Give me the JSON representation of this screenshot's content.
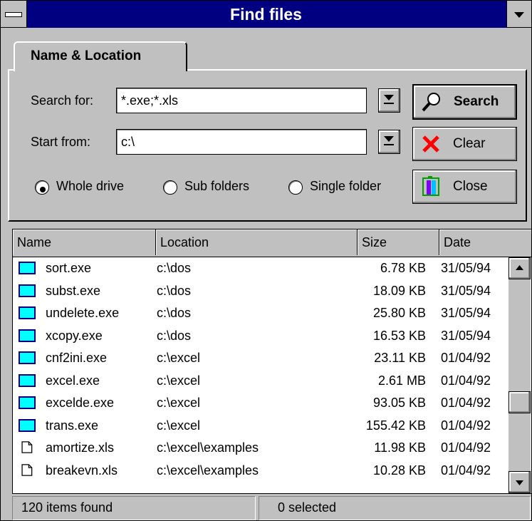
{
  "window": {
    "title": "Find files"
  },
  "tabs": [
    {
      "label": "Name & Location"
    }
  ],
  "form": {
    "search_for_label": "Search for:",
    "search_for_value": "*.exe;*.xls",
    "start_from_label": "Start from:",
    "start_from_value": "c:\\",
    "scope_options": [
      "Whole drive",
      "Sub folders",
      "Single folder"
    ],
    "scope_selected": "Whole drive"
  },
  "buttons": {
    "search": "Search",
    "clear": "Clear",
    "close": "Close"
  },
  "list": {
    "columns": [
      "Name",
      "Location",
      "Size",
      "Date"
    ],
    "rows": [
      {
        "icon": "exe-file-icon",
        "name": "sort.exe",
        "location": "c:\\dos",
        "size": "6.78 KB",
        "date": "31/05/94"
      },
      {
        "icon": "exe-file-icon",
        "name": "subst.exe",
        "location": "c:\\dos",
        "size": "18.09 KB",
        "date": "31/05/94"
      },
      {
        "icon": "exe-file-icon",
        "name": "undelete.exe",
        "location": "c:\\dos",
        "size": "25.80 KB",
        "date": "31/05/94"
      },
      {
        "icon": "exe-file-icon",
        "name": "xcopy.exe",
        "location": "c:\\dos",
        "size": "16.53 KB",
        "date": "31/05/94"
      },
      {
        "icon": "exe-file-icon",
        "name": "cnf2ini.exe",
        "location": "c:\\excel",
        "size": "23.11 KB",
        "date": "01/04/92"
      },
      {
        "icon": "exe-file-icon",
        "name": "excel.exe",
        "location": "c:\\excel",
        "size": "2.61 MB",
        "date": "01/04/92"
      },
      {
        "icon": "exe-file-icon",
        "name": "excelde.exe",
        "location": "c:\\excel",
        "size": "93.05 KB",
        "date": "01/04/92"
      },
      {
        "icon": "exe-file-icon",
        "name": "trans.exe",
        "location": "c:\\excel",
        "size": "155.42 KB",
        "date": "01/04/92"
      },
      {
        "icon": "document-file-icon",
        "name": "amortize.xls",
        "location": "c:\\excel\\examples",
        "size": "11.98 KB",
        "date": "01/04/92"
      },
      {
        "icon": "document-file-icon",
        "name": "breakevn.xls",
        "location": "c:\\excel\\examples",
        "size": "10.28 KB",
        "date": "01/04/92"
      }
    ]
  },
  "status": {
    "found": "120 items found",
    "selected": "0 selected"
  },
  "colors": {
    "titlebar": "#000080",
    "exe_icon": "#00ffff",
    "clear_x": "#ff0000"
  }
}
